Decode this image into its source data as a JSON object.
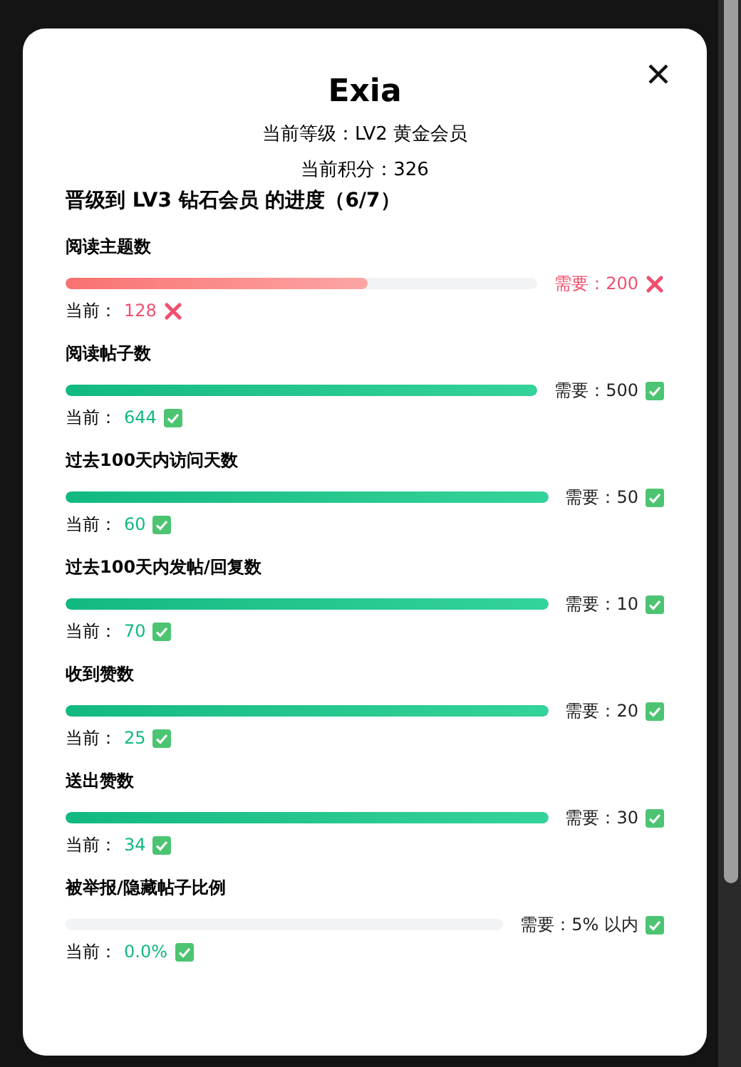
{
  "dialog": {
    "title": "Exia",
    "level_line": "当前等级：LV2 黄金会员",
    "points_line": "当前积分：326",
    "progress_heading": "晋级到 LV3 钻石会员 的进度（6/7）"
  },
  "requirements": [
    {
      "name": "阅读主题数",
      "level": 0.64,
      "required": "需要：200",
      "current_label": "当前：",
      "current": "128",
      "met": false
    },
    {
      "name": "阅读帖子数",
      "level": 1,
      "required": "需要：500",
      "current_label": "当前：",
      "current": "644",
      "met": true
    },
    {
      "name": "过去100天内访问天数",
      "level": 1,
      "required": "需要：50",
      "current_label": "当前：",
      "current": "60",
      "met": true
    },
    {
      "name": "过去100天内发帖/回复数",
      "level": 1,
      "required": "需要：10",
      "current_label": "当前：",
      "current": "70",
      "met": true
    },
    {
      "name": "收到赞数",
      "level": 1,
      "required": "需要：20",
      "current_label": "当前：",
      "current": "25",
      "met": true
    },
    {
      "name": "送出赞数",
      "level": 1,
      "required": "需要：30",
      "current_label": "当前：",
      "current": "34",
      "met": true
    },
    {
      "name": "被举报/隐藏帖子比例",
      "level": 0,
      "required": "需要：5% 以内",
      "current_label": "当前：",
      "current": "0.0%",
      "met": true
    }
  ]
}
